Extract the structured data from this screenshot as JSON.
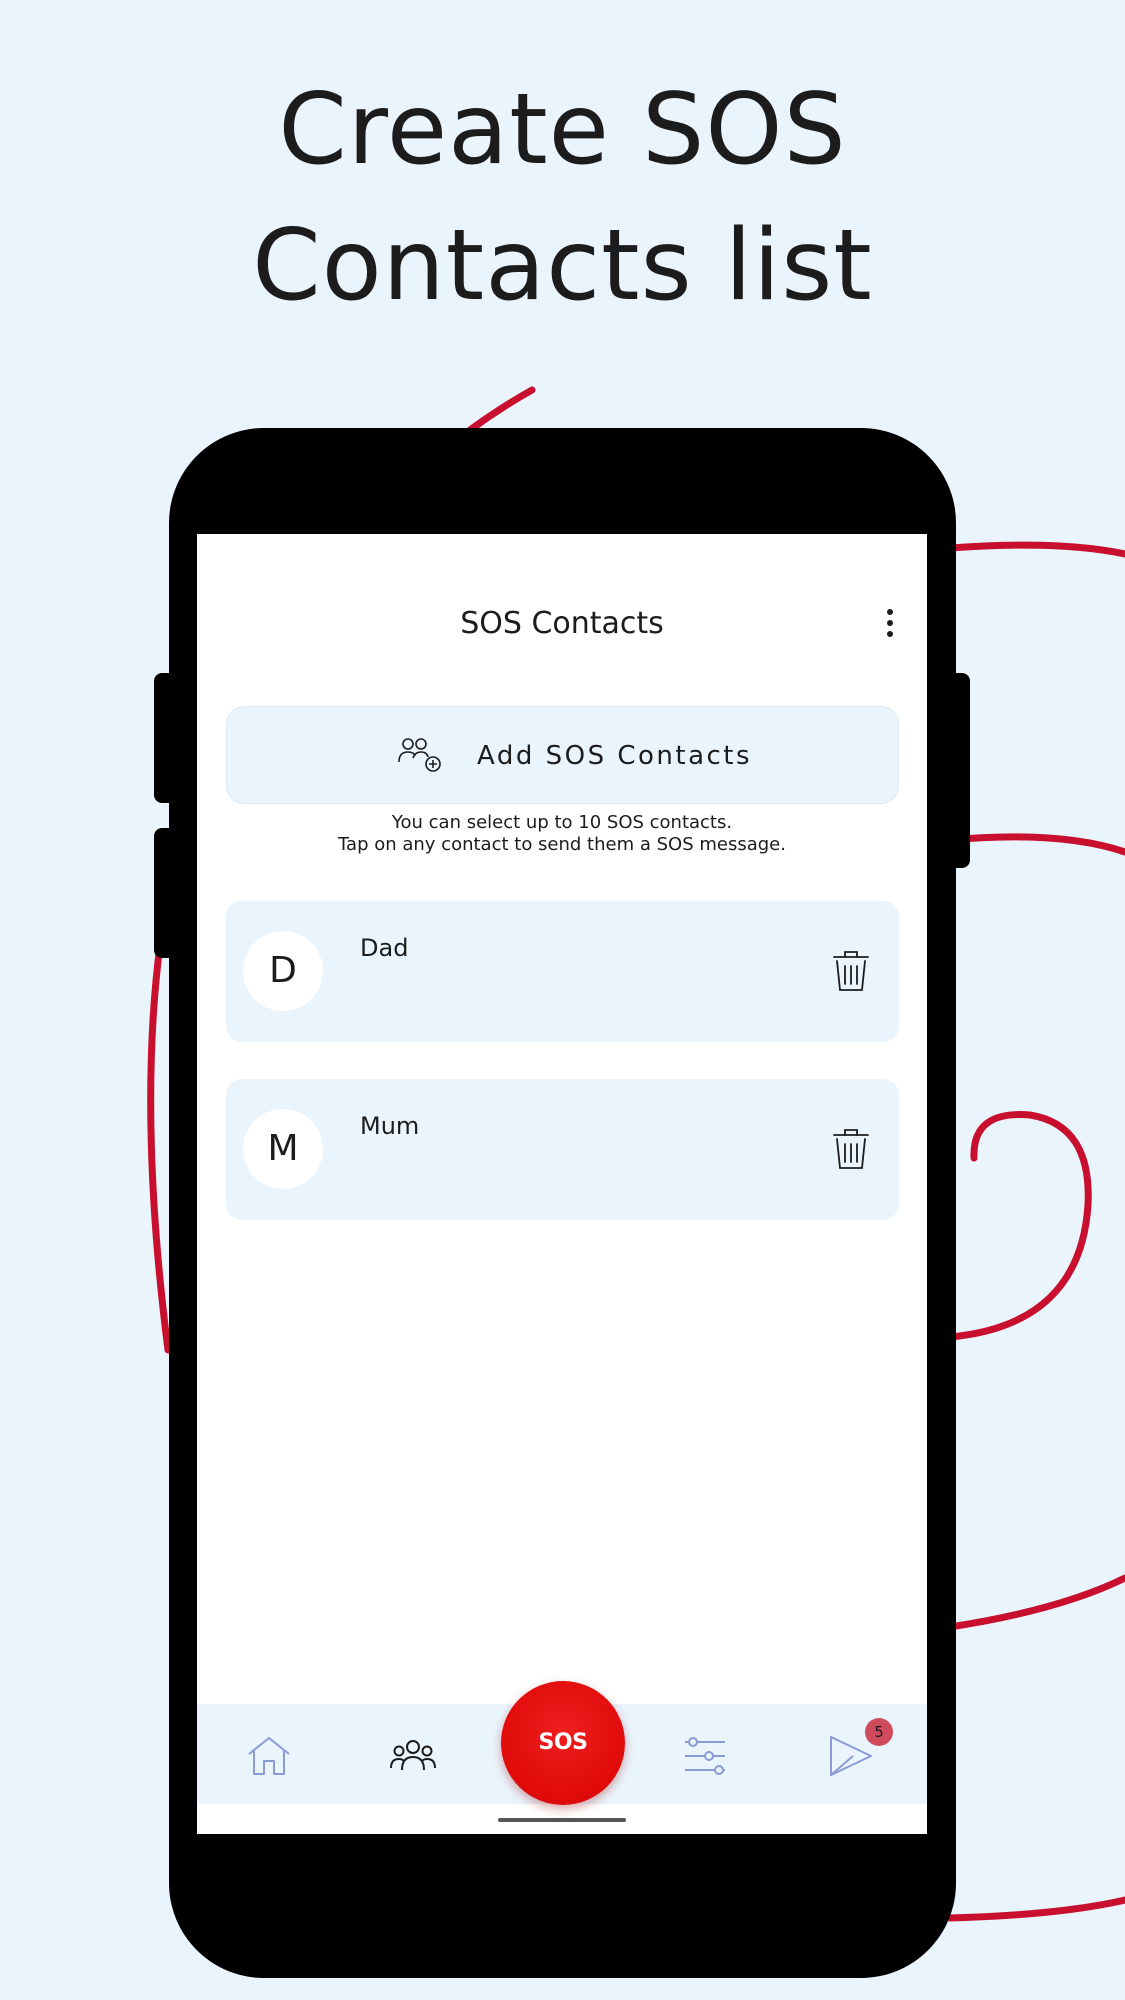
{
  "promo": {
    "headline_line1": "Create SOS",
    "headline_line2": "Contacts list"
  },
  "colors": {
    "background": "#eaf4fd",
    "accent_red": "#c8102e",
    "sos_red": "#e00a0a",
    "card": "#eaf4fd",
    "nav_icon": "#8a9bd6",
    "badge": "#d04a5c"
  },
  "app": {
    "title": "SOS Contacts",
    "menu_icon": "more-vertical-icon",
    "add_button": {
      "label": "Add SOS Contacts",
      "icon": "add-people-icon"
    },
    "hint": {
      "line1": "You can select up to 10 SOS contacts.",
      "line2": "Tap on any contact to send them a SOS message."
    },
    "contacts": [
      {
        "initial": "D",
        "name": "Dad",
        "delete_icon": "trash-icon"
      },
      {
        "initial": "M",
        "name": "Mum",
        "delete_icon": "trash-icon"
      }
    ],
    "bottom_nav": {
      "items": [
        {
          "icon": "home-icon",
          "active": false
        },
        {
          "icon": "contacts-icon",
          "active": true
        },
        {
          "icon": "settings-sliders-icon",
          "active": false
        },
        {
          "icon": "send-icon",
          "active": false
        }
      ],
      "sos_label": "SOS",
      "badge_count": "5"
    }
  }
}
